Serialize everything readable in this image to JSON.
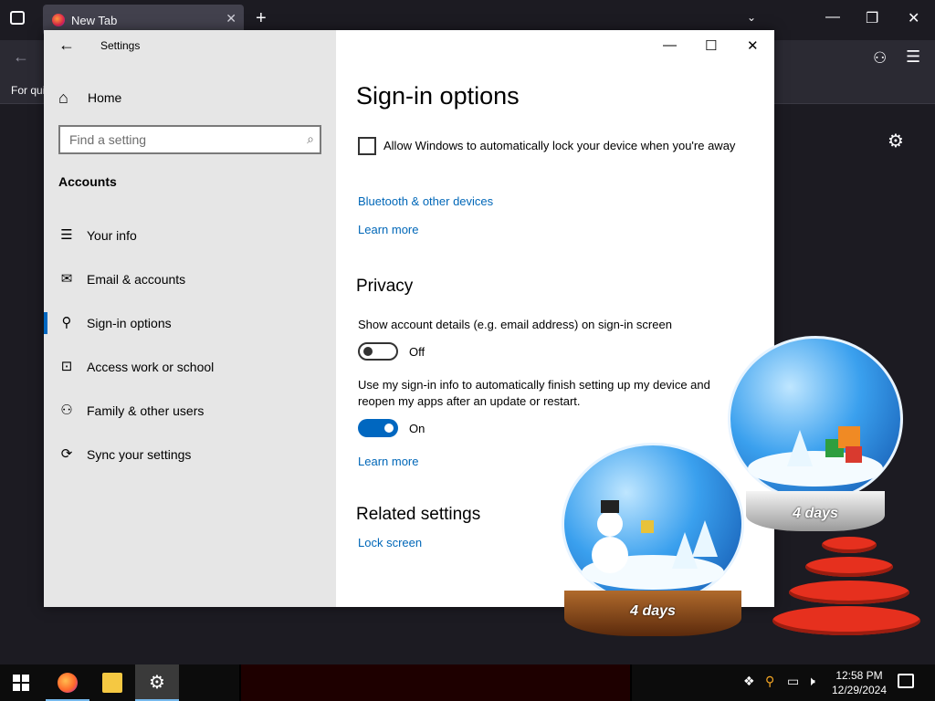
{
  "browser": {
    "tab_title": "New Tab",
    "tab_close": "✕",
    "new_tab": "+",
    "list_tabs": "⌄",
    "minimize": "—",
    "restore": "❐",
    "close": "✕",
    "back": "←",
    "extensions": "⚇",
    "menu": "☰",
    "bookmark_text": "For qui",
    "settings_gear": "⚙"
  },
  "settings": {
    "app_title": "Settings",
    "back": "←",
    "home": {
      "icon": "⌂",
      "label": "Home"
    },
    "search": {
      "placeholder": "Find a setting",
      "icon": "⌕"
    },
    "section_title": "Accounts",
    "nav": [
      {
        "icon": "☰",
        "label": "Your info",
        "active": false
      },
      {
        "icon": "✉",
        "label": "Email & accounts",
        "active": false
      },
      {
        "icon": "⚲",
        "label": "Sign-in options",
        "active": true
      },
      {
        "icon": "⊡",
        "label": "Access work or school",
        "active": false
      },
      {
        "icon": "⚇",
        "label": "Family & other users",
        "active": false
      },
      {
        "icon": "⟳",
        "label": "Sync your settings",
        "active": false
      }
    ],
    "window_controls": {
      "minimize": "—",
      "maximize": "☐",
      "close": "✕"
    },
    "page_title": "Sign-in options",
    "dynamic_lock": {
      "checked": false,
      "label": "Allow Windows to automatically lock your device when you're away"
    },
    "bluetooth_link": "Bluetooth & other devices",
    "learn_more_1": "Learn more",
    "privacy": {
      "heading": "Privacy",
      "account_details": {
        "description": "Show account details (e.g. email address) on sign-in screen",
        "state": "Off",
        "on": false
      },
      "signin_info": {
        "description": "Use my sign-in info to automatically finish setting up my device and reopen my apps after an update or restart.",
        "state": "On",
        "on": true
      },
      "learn_more": "Learn more"
    },
    "related": {
      "heading": "Related settings",
      "lock_screen": "Lock screen"
    }
  },
  "decoration": {
    "globe_left_label": "4 days",
    "globe_right_label": "4 days"
  },
  "taskbar": {
    "apps": [
      "firefox-icon",
      "file-explorer-icon",
      "settings-icon"
    ],
    "tray": {
      "icons": [
        "network-icon",
        "search-icon",
        "monitor-icon",
        "volume-muted-icon"
      ],
      "time": "12:58 PM",
      "date": "12/29/2024"
    }
  },
  "colors": {
    "accent": "#0067c0",
    "link": "#0067b8",
    "sidebar_bg": "#e6e6e6",
    "browser_bg": "#1c1b22"
  }
}
